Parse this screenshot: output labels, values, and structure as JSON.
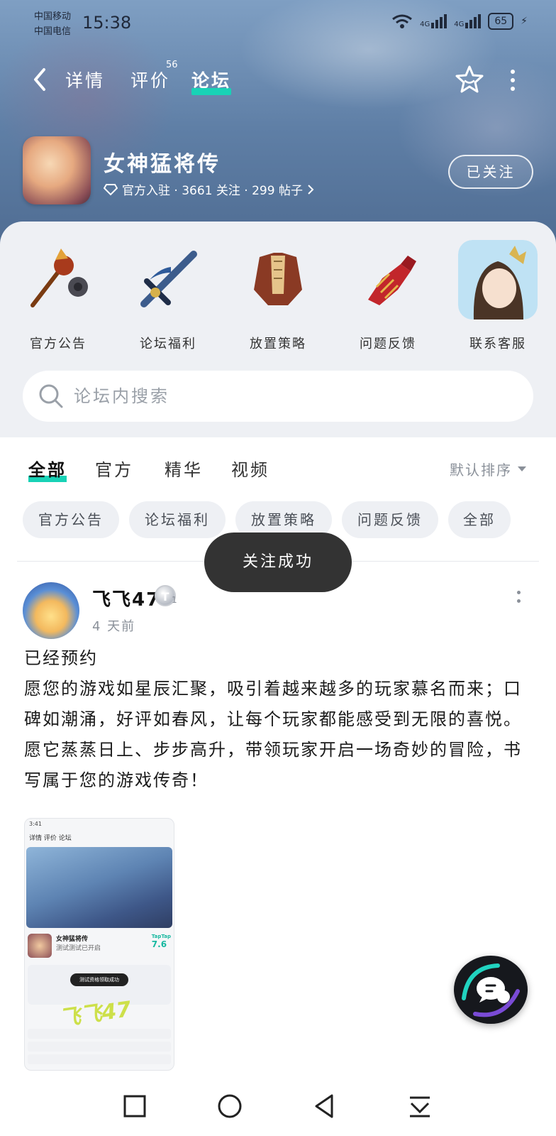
{
  "status_bar": {
    "carrier_1": "中国移动",
    "carrier_2": "中国电信",
    "time": "15:38",
    "signal_1": "4G",
    "signal_2": "4G",
    "battery": "65"
  },
  "nav": {
    "tabs": [
      {
        "label": "详情"
      },
      {
        "label": "评价"
      },
      {
        "label": "论坛"
      }
    ],
    "review_count": "56",
    "active_tab": "论坛"
  },
  "game": {
    "name": "女神猛将传",
    "meta": "官方入驻 · 3661 关注 · 299 帖子",
    "follow_label": "已关注"
  },
  "quick_links": [
    {
      "label": "官方公告",
      "icon": "mace-icon"
    },
    {
      "label": "论坛福利",
      "icon": "sword-icon"
    },
    {
      "label": "放置策略",
      "icon": "armor-icon"
    },
    {
      "label": "问题反馈",
      "icon": "gauntlet-icon"
    },
    {
      "label": "联系客服",
      "icon": "support-avatar-icon"
    }
  ],
  "search": {
    "placeholder": "论坛内搜索"
  },
  "filter_tabs": [
    {
      "label": "全部"
    },
    {
      "label": "官方"
    },
    {
      "label": "精华"
    },
    {
      "label": "视频"
    }
  ],
  "sort_label": "默认排序",
  "chips": [
    {
      "label": "官方公告"
    },
    {
      "label": "论坛福利"
    },
    {
      "label": "放置策略"
    },
    {
      "label": "问题反馈"
    },
    {
      "label": "全部"
    }
  ],
  "toast": "关注成功",
  "post": {
    "author": "飞飞47",
    "level": "T",
    "level_num": "1",
    "time": "4 天前",
    "body_line1": "已经预约",
    "body_text": "愿您的游戏如星辰汇聚，吸引着越来越多的玩家慕名而来；口碑如潮涌，好评如春风，让每个玩家都能感受到无限的喜悦。愿它蒸蒸日上、步步高升，带领玩家开启一场奇妙的冒险，书写属于您的游戏传奇！",
    "image": {
      "status_time": "3:41",
      "nav_tabs": "详情  评价  论坛",
      "game_name": "女神猛将传",
      "game_sub": "测试测试已开启",
      "score_brand": "TapTap",
      "score": "7.6",
      "toast": "测试资格领取成功",
      "signature": "飞飞47"
    }
  },
  "colors": {
    "accent": "#18d2b6",
    "toast_bg": "#333333",
    "hero": "#5f7fa6"
  }
}
